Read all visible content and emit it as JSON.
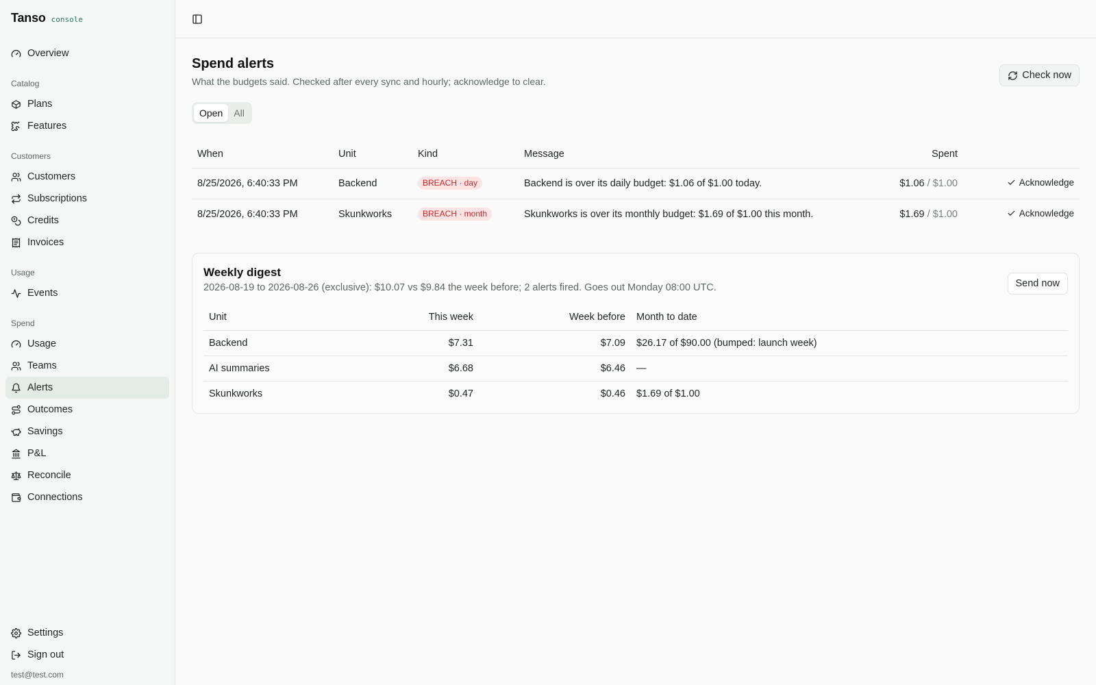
{
  "brand": {
    "name": "Tanso",
    "tag": "console"
  },
  "sidebar": {
    "overview": "Overview",
    "catalog_label": "Catalog",
    "catalog": [
      "Plans",
      "Features"
    ],
    "customers_label": "Customers",
    "customers": [
      "Customers",
      "Subscriptions",
      "Credits",
      "Invoices"
    ],
    "usage_label": "Usage",
    "usage": [
      "Events"
    ],
    "spend_label": "Spend",
    "spend": [
      "Usage",
      "Teams",
      "Alerts",
      "Outcomes",
      "Savings",
      "P&L",
      "Reconcile",
      "Connections"
    ],
    "settings": "Settings",
    "sign_out": "Sign out",
    "email": "test@test.com"
  },
  "page": {
    "title": "Spend alerts",
    "subtitle": "What the budgets said. Checked after every sync and hourly; acknowledge to clear.",
    "check_now": "Check now",
    "filter": {
      "open": "Open",
      "all": "All",
      "selected": "Open"
    }
  },
  "alerts": {
    "columns": {
      "when": "When",
      "unit": "Unit",
      "kind": "Kind",
      "message": "Message",
      "spent": "Spent"
    },
    "rows": [
      {
        "when": "8/25/2026, 6:40:33 PM",
        "unit": "Backend",
        "kind": "BREACH · day",
        "message": "Backend is over its daily budget: $1.06 of $1.00 today.",
        "spent": "$1.06",
        "budget": "/ $1.00",
        "action": "Acknowledge"
      },
      {
        "when": "8/25/2026, 6:40:33 PM",
        "unit": "Skunkworks",
        "kind": "BREACH · month",
        "message": "Skunkworks is over its monthly budget: $1.69 of $1.00 this month.",
        "spent": "$1.69",
        "budget": "/ $1.00",
        "action": "Acknowledge"
      }
    ]
  },
  "digest": {
    "title": "Weekly digest",
    "subtitle": "2026-08-19 to 2026-08-26 (exclusive): $10.07 vs $9.84 the week before; 2 alerts fired. Goes out Monday 08:00 UTC.",
    "send_now": "Send now",
    "columns": {
      "unit": "Unit",
      "this_week": "This week",
      "week_before": "Week before",
      "mtd": "Month to date"
    },
    "rows": [
      {
        "unit": "Backend",
        "this_week": "$7.31",
        "week_before": "$7.09",
        "mtd": "$26.17 of $90.00 (bumped: launch week)"
      },
      {
        "unit": "AI summaries",
        "this_week": "$6.68",
        "week_before": "$6.46",
        "mtd": "—"
      },
      {
        "unit": "Skunkworks",
        "this_week": "$0.47",
        "week_before": "$0.46",
        "mtd": "$1.69 of $1.00"
      }
    ]
  },
  "colors": {
    "accent": "#2f7a5a",
    "breach_bg": "#fde4e4",
    "breach_text": "#c62828",
    "active_nav": "#e5ece8"
  }
}
